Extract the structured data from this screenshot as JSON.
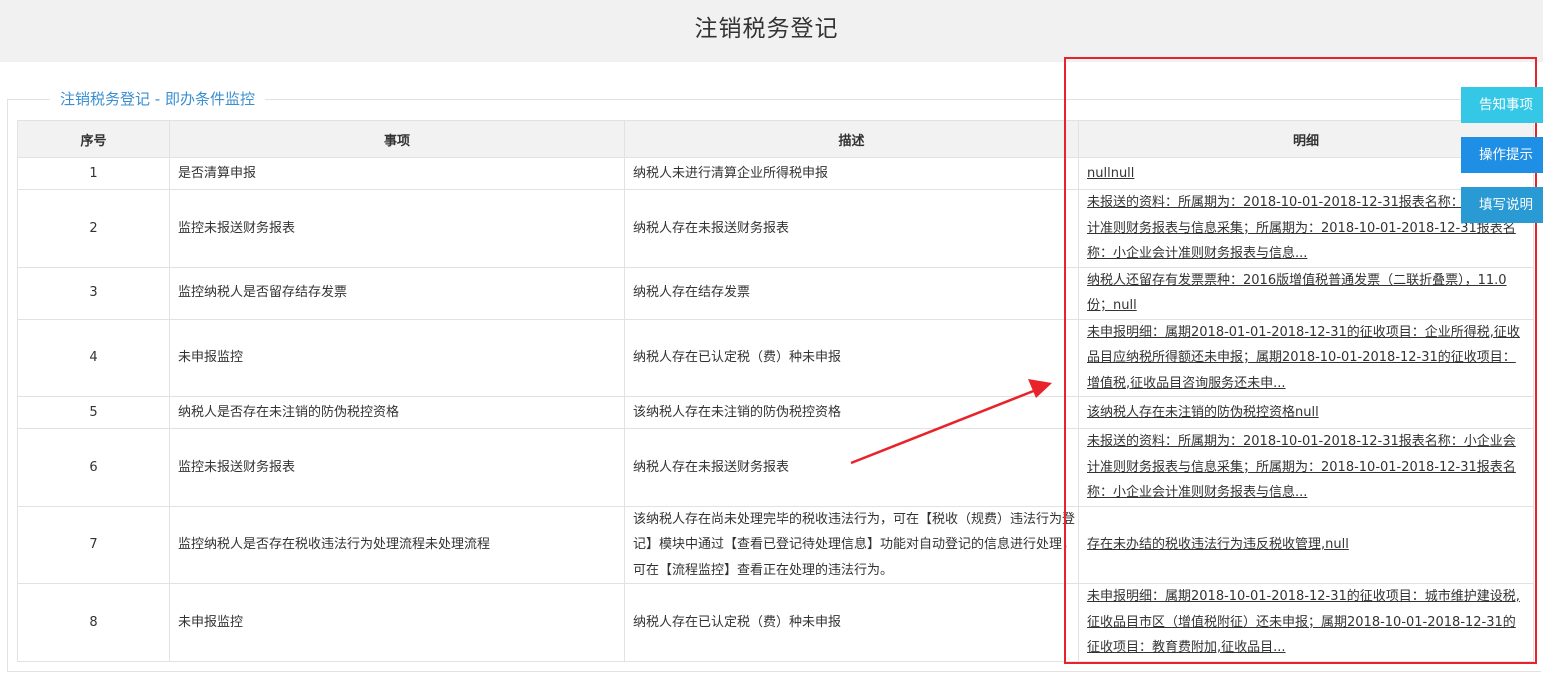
{
  "page": {
    "title": "注销税务登记"
  },
  "section": {
    "legend": "注销税务登记 - 即办条件监控"
  },
  "table": {
    "headers": [
      "序号",
      "事项",
      "描述",
      "明细"
    ],
    "rows": [
      {
        "no": "1",
        "item": "是否清算申报",
        "desc": "纳税人未进行清算企业所得税申报",
        "detail": "nullnull"
      },
      {
        "no": "2",
        "item": "监控未报送财务报表",
        "desc": "纳税人存在未报送财务报表",
        "detail": "未报送的资料：所属期为：2018-10-01-2018-12-31报表名称：小企业会计准则财务报表与信息采集；所属期为：2018-10-01-2018-12-31报表名称：小企业会计准则财务报表与信息..."
      },
      {
        "no": "3",
        "item": "监控纳税人是否留存结存发票",
        "desc": "纳税人存在结存发票",
        "detail": "纳税人还留存有发票票种：2016版增值税普通发票（二联折叠票），11.0份；null"
      },
      {
        "no": "4",
        "item": "未申报监控",
        "desc": "纳税人存在已认定税（费）种未申报",
        "detail": "未申报明细：属期2018-01-01-2018-12-31的征收项目：企业所得税,征收品目应纳税所得额还未申报；属期2018-10-01-2018-12-31的征收项目：增值税,征收品目咨询服务还未申..."
      },
      {
        "no": "5",
        "item": "纳税人是否存在未注销的防伪税控资格",
        "desc": "该纳税人存在未注销的防伪税控资格",
        "detail": "该纳税人存在未注销的防伪税控资格null"
      },
      {
        "no": "6",
        "item": "监控未报送财务报表",
        "desc": "纳税人存在未报送财务报表",
        "detail": "未报送的资料：所属期为：2018-10-01-2018-12-31报表名称：小企业会计准则财务报表与信息采集；所属期为：2018-10-01-2018-12-31报表名称：小企业会计准则财务报表与信息..."
      },
      {
        "no": "7",
        "item": "监控纳税人是否存在税收违法行为处理流程未处理流程",
        "desc": "该纳税人存在尚未处理完毕的税收违法行为，可在【税收（规费）违法行为登记】模块中通过【查看已登记待处理信息】功能对自动登记的信息进行处理，可在【流程监控】查看正在处理的违法行为。",
        "detail": "存在未办结的税收违法行为违反税收管理,null"
      },
      {
        "no": "8",
        "item": "未申报监控",
        "desc": "纳税人存在已认定税（费）种未申报",
        "detail": "未申报明细：属期2018-10-01-2018-12-31的征收项目：城市维护建设税,征收品目市区（增值税附征）还未申报；属期2018-10-01-2018-12-31的征收项目：教育费附加,征收品目..."
      }
    ]
  },
  "side_buttons": {
    "notice": "告知事项",
    "tips": "操作提示",
    "fill": "填写说明"
  },
  "colors": {
    "accent": "#3a8fd0",
    "annotation_red": "#e8232a",
    "btn_notice": "#35c8e6",
    "btn_tips": "#1f8fe6",
    "btn_fill": "#2a9ad4"
  }
}
